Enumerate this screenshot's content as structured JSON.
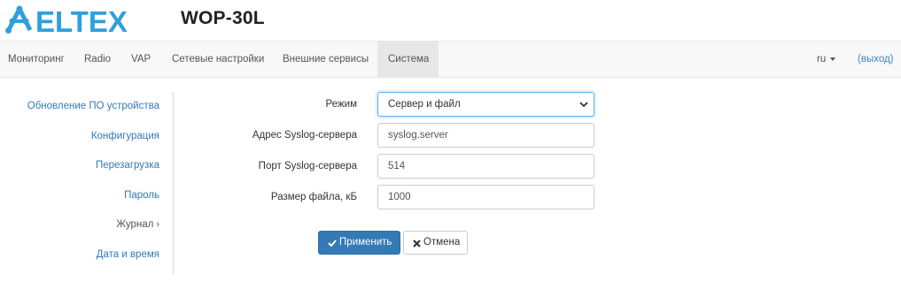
{
  "brand": {
    "logo_text": "ELTEX",
    "logo_color": "#2f9fe0"
  },
  "model": "WOP-30L",
  "nav": {
    "items": [
      "Мониторинг",
      "Radio",
      "VAP",
      "Сетевые настройки",
      "Внешние сервисы",
      "Система"
    ],
    "active": "Система",
    "lang": "ru",
    "logout": "(выход)"
  },
  "sidebar": {
    "items": [
      "Обновление ПО устройства",
      "Конфигурация",
      "Перезагрузка",
      "Пароль",
      "Журнал",
      "Дата и время"
    ],
    "current": "Журнал"
  },
  "form": {
    "mode": {
      "label": "Режим",
      "value": "Сервер и файл"
    },
    "syslog_address": {
      "label": "Адрес Syslog-сервера",
      "value": "syslog.server"
    },
    "syslog_port": {
      "label": "Порт Syslog-сервера",
      "value": "514"
    },
    "file_size": {
      "label": "Размер файла, кБ",
      "value": "1000"
    }
  },
  "buttons": {
    "apply": "Применить",
    "cancel": "Отмена"
  },
  "colors": {
    "link": "#337ab7",
    "primary": "#337ab7",
    "nav_bg": "#f8f8f8",
    "nav_active": "#e7e7e7"
  },
  "icons": {
    "apply": "check-icon",
    "cancel": "x-icon",
    "select": "chevron-down-icon",
    "lang": "caret-down-icon",
    "sidebar_current": "chevron-right-icon"
  }
}
